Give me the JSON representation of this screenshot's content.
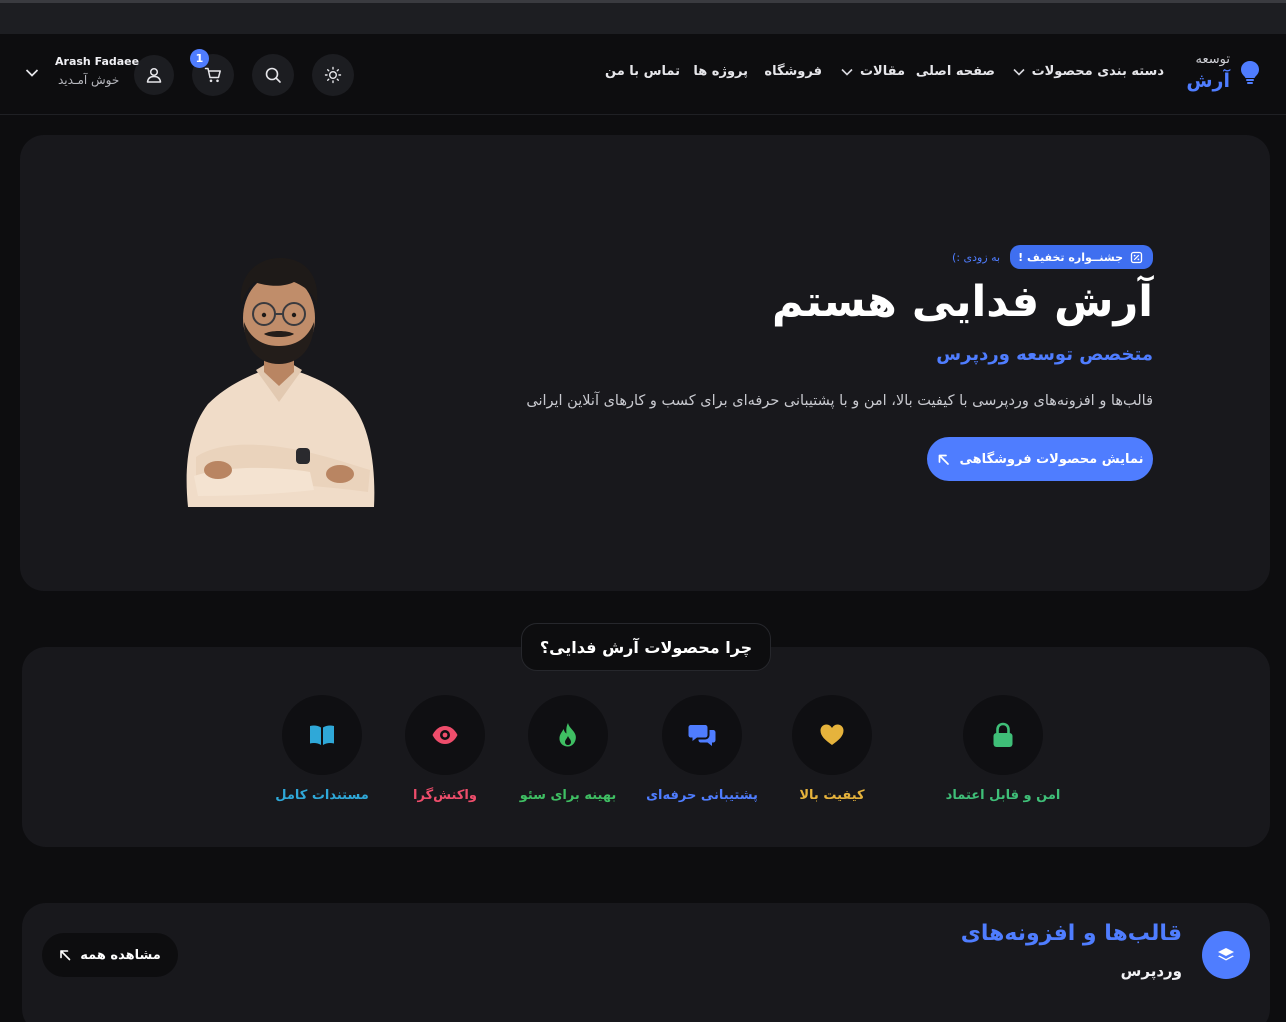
{
  "header": {
    "logo_top": "توسعه",
    "logo_main": "آرش",
    "nav": [
      {
        "label": "دسته بندی محصولات"
      },
      {
        "label": "صفحه اصلی"
      },
      {
        "label": "مقالات"
      },
      {
        "label": "فروشگاه"
      },
      {
        "label": "پروژه ها"
      },
      {
        "label": "تماس با من"
      }
    ],
    "cart_count": "1",
    "user_name": "Arash Fadaee",
    "user_welcome": "خوش آمـدید",
    "icons": [
      "sun-icon",
      "search-icon",
      "cart-icon",
      "user-icon",
      "chevron-down-icon"
    ]
  },
  "hero": {
    "badge": "جشنــواره تخفیف !",
    "badge_soon": "به زودی :)",
    "title": "آرش فدایی هستم",
    "subtitle": "متخصص توسعه وردپرس",
    "description": "قالب‌ها و افزونه‌های وردپرسی با کیفیت بالا، امن و با پشتیبانی حرفه‌ای برای کسب و کارهای آنلاین ایرانی",
    "button": "نمایش محصولات فروشگاهی"
  },
  "why": {
    "title": "چرا محصولات آرش فدایی؟",
    "features": [
      {
        "label": "امن و قابل اعتماد",
        "icon": "lock-icon",
        "color": "#3fbf78"
      },
      {
        "label": "کیفیت بالا",
        "icon": "heart-icon",
        "color": "#e6b33c"
      },
      {
        "label": "پشتیبانی حرفه‌ای",
        "icon": "chat-icon",
        "color": "#4f7dff"
      },
      {
        "label": "بهینه برای سئو",
        "icon": "flame-icon",
        "color": "#3fbf63"
      },
      {
        "label": "واکنش‌گرا",
        "icon": "eye-icon",
        "color": "#ee4d6b"
      },
      {
        "label": "مستندات کامل",
        "icon": "book-icon",
        "color": "#2fa8d8"
      }
    ]
  },
  "products": {
    "title": "قالب‌ها و افزونه‌های",
    "subtitle": "وردپرس",
    "view_all": "مشاهده همه"
  }
}
